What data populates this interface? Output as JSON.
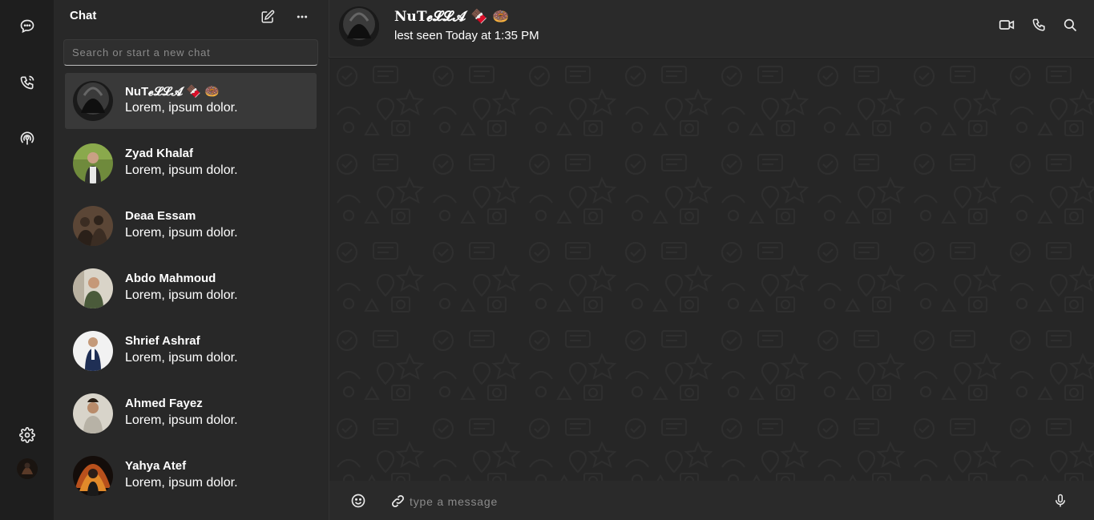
{
  "rail": {
    "icons": [
      "chat-icon",
      "calls-icon",
      "status-icon",
      "settings-icon"
    ]
  },
  "chat_list": {
    "title": "Chat",
    "search_placeholder": "Search or start a new chat",
    "chats": [
      {
        "name": "NuT𝓮𝓛𝓛𝓐 🍫 🍩",
        "preview": "Lorem, ipsum dolor.",
        "active": true
      },
      {
        "name": "Zyad Khalaf",
        "preview": "Lorem, ipsum dolor."
      },
      {
        "name": "Deaa Essam",
        "preview": "Lorem, ipsum dolor."
      },
      {
        "name": "Abdo Mahmoud",
        "preview": "Lorem, ipsum dolor."
      },
      {
        "name": "Shrief Ashraf",
        "preview": "Lorem, ipsum dolor."
      },
      {
        "name": "Ahmed Fayez",
        "preview": "Lorem, ipsum dolor."
      },
      {
        "name": "Yahya Atef",
        "preview": "Lorem, ipsum dolor."
      }
    ]
  },
  "conversation": {
    "title": "NuT𝓮𝓛𝓛𝓐 🍫 🍩",
    "status": "lest seen Today at 1:35 PM",
    "message_placeholder": "type a message"
  },
  "colors": {
    "rail_bg": "#1e1e1e",
    "list_bg": "#282828",
    "active_chat_bg": "#393939",
    "header_bg": "#2a2a2a",
    "wallpaper_bg": "#262626"
  }
}
